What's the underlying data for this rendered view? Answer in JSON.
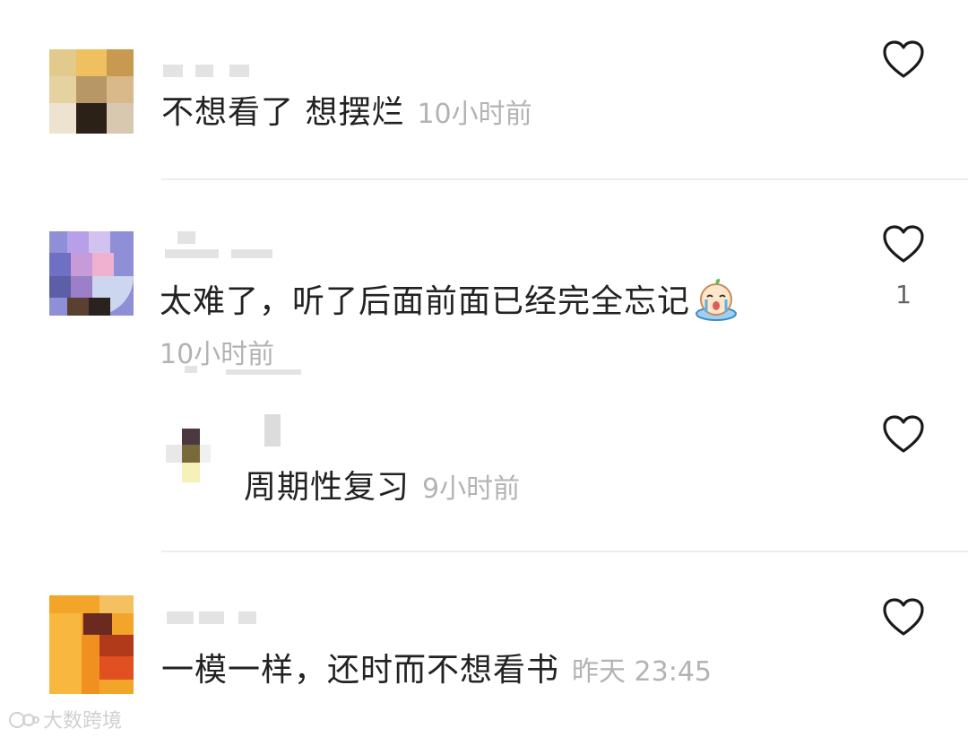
{
  "comments": [
    {
      "text": "不想看了 想摆烂",
      "time": "10小时前",
      "likes": ""
    },
    {
      "text": "太难了，听了后面前面已经完全忘记",
      "emoji": "crying-face-emoji",
      "time": "10小时前",
      "likes": "1"
    },
    {
      "text": "周期性复习",
      "time": "9小时前",
      "likes": ""
    },
    {
      "text": "一模一样，还时而不想看书",
      "time": "昨天 23:45",
      "likes": ""
    }
  ],
  "icons": {
    "like": "heart-outline-icon"
  },
  "colors": {
    "text": "#222222",
    "meta": "#b3b3b3",
    "divider": "#ededed",
    "background": "#ffffff"
  },
  "watermark": {
    "text": "大数跨境"
  }
}
